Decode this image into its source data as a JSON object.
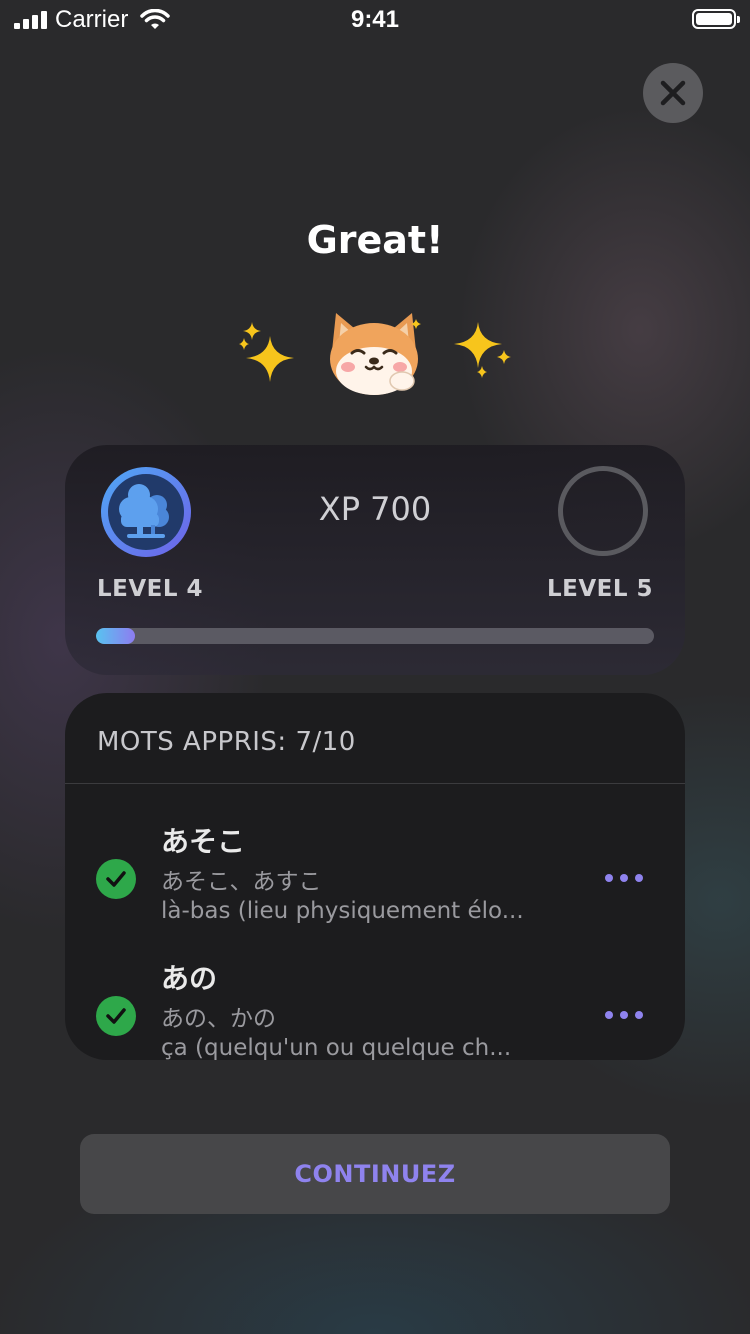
{
  "status_bar": {
    "carrier": "Carrier",
    "time": "9:41"
  },
  "title": "Great!",
  "xp_card": {
    "xp": "XP 700",
    "current_level": "LEVEL 4",
    "next_level": "LEVEL 5",
    "progress_fraction": 0.07
  },
  "words": {
    "header": "MOTS APPRIS: 7/10",
    "items": [
      {
        "word": "あそこ",
        "kana": "あそこ、あすこ",
        "definition": "là-bas (lieu physiquement élo..."
      },
      {
        "word": "あの",
        "kana": "あの、かの",
        "definition": "ça (quelqu'un ou quelque ch..."
      }
    ]
  },
  "continue_label": "CONTINUEZ",
  "colors": {
    "accent": "#8f83ee",
    "check": "#2ea84a",
    "progress_start": "#58c3f0",
    "progress_end": "#8e7cf0"
  }
}
